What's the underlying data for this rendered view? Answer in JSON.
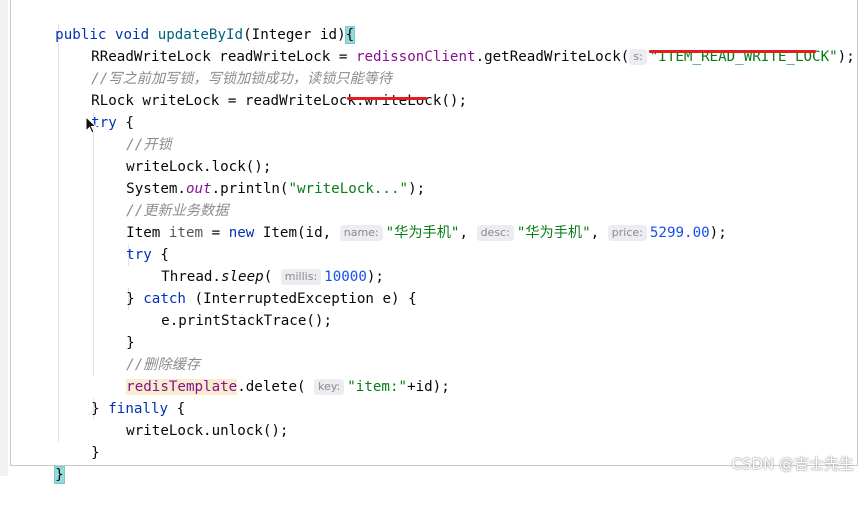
{
  "editor": {
    "language": "java",
    "lines": {
      "l1": {
        "kw1": "public",
        "kw2": "void",
        "method": "updateById",
        "rest": "(Integer id)",
        "brace": "{"
      },
      "l2": {
        "a": "RReadWriteLock readWriteLock = ",
        "field": "redissonClient",
        "b": ".getReadWriteLock(",
        "hint": "s:",
        "str": "\"ITEM_READ_WRITE_LOCK\"",
        "c": ");"
      },
      "l3": {
        "comment": "//写之前加写锁，写锁加锁成功，读锁只能等待"
      },
      "l4": {
        "text": "RLock writeLock = readWriteLock.writeLock();"
      },
      "l5": {
        "kw": "try",
        "rest": " {"
      },
      "l6": {
        "comment": "//开锁"
      },
      "l7": {
        "text": "writeLock.lock();"
      },
      "l8": {
        "a": "System.",
        "field": "out",
        "b": ".println(",
        "str": "\"writeLock...\"",
        "c": ");"
      },
      "l9": {
        "comment": "//更新业务数据"
      },
      "l10": {
        "a": "Item ",
        "var": "item",
        "b": " = ",
        "kw": "new",
        "c": " Item(id, ",
        "hint1": "name:",
        "str1": "\"华为手机\"",
        "d": ", ",
        "hint2": "desc:",
        "str2": "\"华为手机\"",
        "e": ", ",
        "hint3": "price:",
        "num": "5299.00",
        "f": ");"
      },
      "l11": {
        "kw": "try",
        "rest": " {"
      },
      "l12": {
        "a": "Thread.",
        "method": "sleep",
        "b": "( ",
        "hint": "millis:",
        "num": "10000",
        "c": ");"
      },
      "l13": {
        "a": "} ",
        "kw": "catch",
        "b": " (InterruptedException e) {"
      },
      "l14": {
        "text": "e.printStackTrace();"
      },
      "l15": {
        "text": "}"
      },
      "l16": {
        "comment": "//删除缓存"
      },
      "l17": {
        "field": "redisTemplate",
        "a": ".delete( ",
        "hint": "key:",
        "str": "\"item:\"",
        "b": "+id);"
      },
      "l18": {
        "a": "} ",
        "kw": "finally",
        "b": " {"
      },
      "l19": {
        "text": "writeLock.unlock();"
      },
      "l20": {
        "text": "}"
      },
      "l21": {
        "brace": "}"
      }
    }
  },
  "watermark": "CSDN @吉士先生",
  "colors": {
    "keyword": "#0033b3",
    "method": "#00627a",
    "field": "#871094",
    "string": "#067d17",
    "number": "#1750eb",
    "comment": "#8c8c8c",
    "annotation_underline": "#e31e1e",
    "brace_match": "#93d9d9"
  },
  "icons": [
    "mouse-pointer-icon"
  ]
}
